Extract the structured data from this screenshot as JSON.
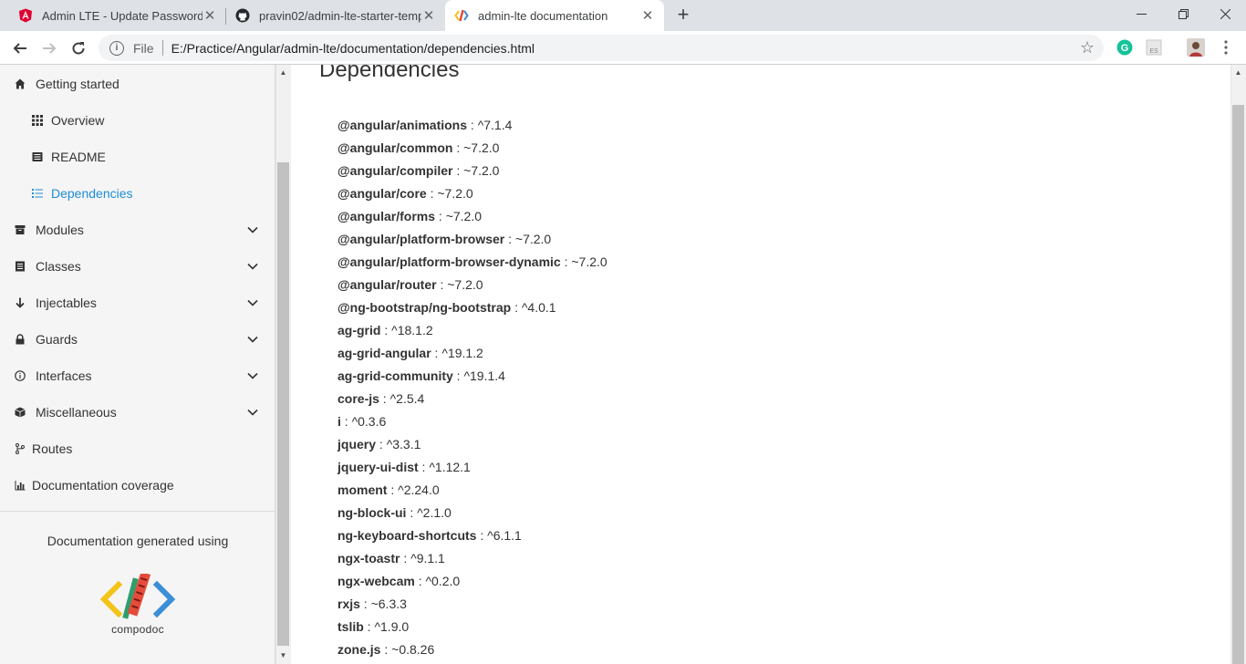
{
  "browser": {
    "tabs": [
      {
        "title": "Admin LTE - Update Password",
        "favicon": "angular-icon"
      },
      {
        "title": "pravin02/admin-lte-starter-temp",
        "favicon": "github-icon"
      },
      {
        "title": "admin-lte documentation",
        "favicon": "compodoc-icon",
        "active": true
      }
    ],
    "new_tab": "+",
    "address": {
      "scheme_label": "File",
      "url": "E:/Practice/Angular/admin-lte/documentation/dependencies.html"
    },
    "extensions": [
      "grammarly-icon",
      "es-extension-icon",
      "profile-avatar"
    ]
  },
  "sidebar": {
    "items": [
      {
        "label": "Getting started",
        "icon": "home-icon",
        "level": 0
      },
      {
        "label": "Overview",
        "icon": "grid-icon",
        "level": 1
      },
      {
        "label": "README",
        "icon": "book-icon",
        "level": 1
      },
      {
        "label": "Dependencies",
        "icon": "list-icon",
        "level": 1,
        "active": true
      },
      {
        "label": "Modules",
        "icon": "archive-icon",
        "level": 0,
        "expandable": true
      },
      {
        "label": "Classes",
        "icon": "file-icon",
        "level": 0,
        "expandable": true
      },
      {
        "label": "Injectables",
        "icon": "arrow-down-icon",
        "level": 0,
        "expandable": true
      },
      {
        "label": "Guards",
        "icon": "lock-icon",
        "level": 0,
        "expandable": true
      },
      {
        "label": "Interfaces",
        "icon": "info-icon",
        "level": 0,
        "expandable": true
      },
      {
        "label": "Miscellaneous",
        "icon": "cube-icon",
        "level": 0,
        "expandable": true
      },
      {
        "label": "Routes",
        "icon": "routes-icon",
        "level": 0
      },
      {
        "label": "Documentation coverage",
        "icon": "bar-chart-icon",
        "level": 0
      }
    ],
    "generated_text": "Documentation generated using",
    "logo_text": "compodoc",
    "accent_color": "#1d8dd6"
  },
  "content": {
    "title": "Dependencies",
    "dependencies": [
      {
        "name": "@angular/animations",
        "version": "^7.1.4"
      },
      {
        "name": "@angular/common",
        "version": "~7.2.0"
      },
      {
        "name": "@angular/compiler",
        "version": "~7.2.0"
      },
      {
        "name": "@angular/core",
        "version": "~7.2.0"
      },
      {
        "name": "@angular/forms",
        "version": "~7.2.0"
      },
      {
        "name": "@angular/platform-browser",
        "version": "~7.2.0"
      },
      {
        "name": "@angular/platform-browser-dynamic",
        "version": "~7.2.0"
      },
      {
        "name": "@angular/router",
        "version": "~7.2.0"
      },
      {
        "name": "@ng-bootstrap/ng-bootstrap",
        "version": "^4.0.1"
      },
      {
        "name": "ag-grid",
        "version": "^18.1.2"
      },
      {
        "name": "ag-grid-angular",
        "version": "^19.1.2"
      },
      {
        "name": "ag-grid-community",
        "version": "^19.1.4"
      },
      {
        "name": "core-js",
        "version": "^2.5.4"
      },
      {
        "name": "i",
        "version": "^0.3.6"
      },
      {
        "name": "jquery",
        "version": "^3.3.1"
      },
      {
        "name": "jquery-ui-dist",
        "version": "^1.12.1"
      },
      {
        "name": "moment",
        "version": "^2.24.0"
      },
      {
        "name": "ng-block-ui",
        "version": "^2.1.0"
      },
      {
        "name": "ng-keyboard-shortcuts",
        "version": "^6.1.1"
      },
      {
        "name": "ngx-toastr",
        "version": "^9.1.1"
      },
      {
        "name": "ngx-webcam",
        "version": "^0.2.0"
      },
      {
        "name": "rxjs",
        "version": "~6.3.3"
      },
      {
        "name": "tslib",
        "version": "^1.9.0"
      },
      {
        "name": "zone.js",
        "version": "~0.8.26"
      }
    ]
  }
}
